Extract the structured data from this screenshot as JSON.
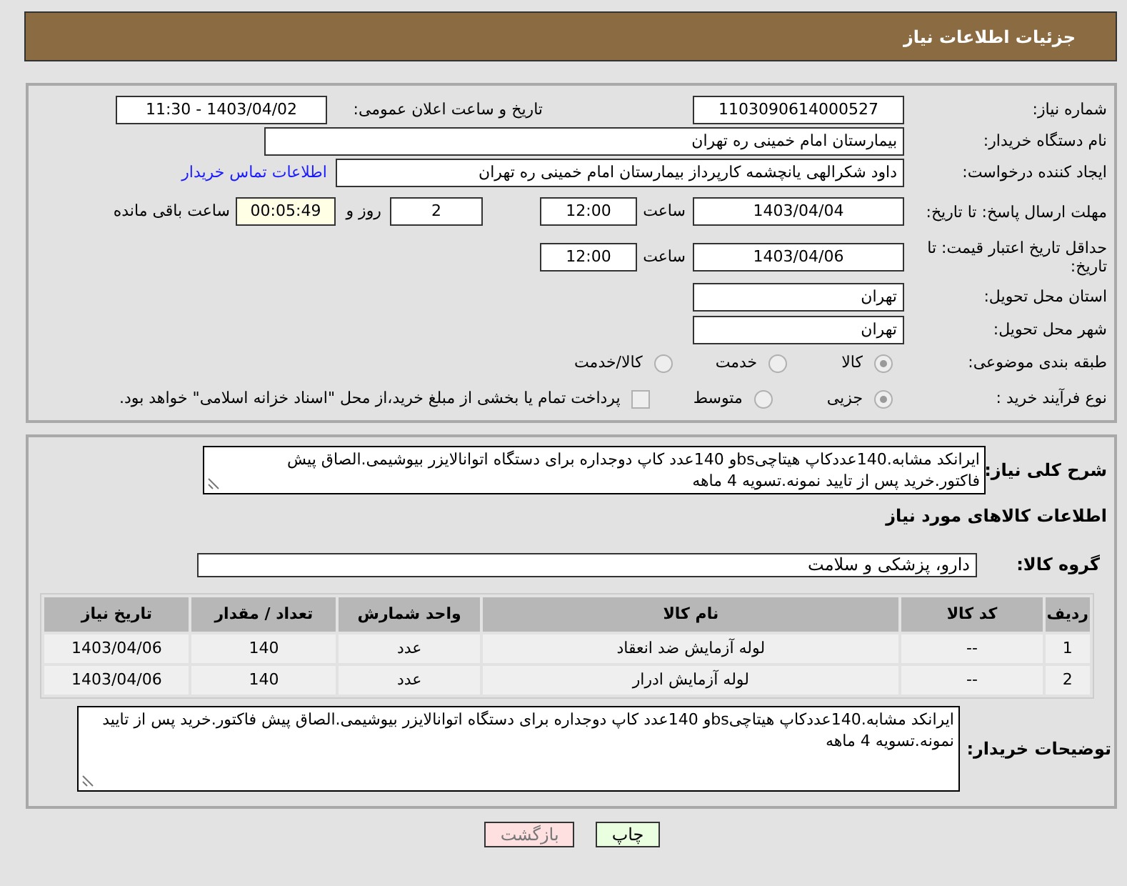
{
  "header": {
    "title": "جزئیات اطلاعات نیاز"
  },
  "need_number": {
    "label": "شماره نیاز:",
    "value": "1103090614000527"
  },
  "announce": {
    "label": "تاریخ و ساعت اعلان عمومی:",
    "value": "1403/04/02 - 11:30"
  },
  "buyer_org": {
    "label": "نام دستگاه خریدار:",
    "value": "بیمارستان امام خمینی ره  تهران"
  },
  "requester": {
    "label": "ایجاد کننده درخواست:",
    "value": "داود شکرالهی یانچشمه کارپرداز بیمارستان امام خمینی ره  تهران",
    "link": "اطلاعات تماس خریدار"
  },
  "response_deadline": {
    "label": "مهلت ارسال پاسخ: تا تاریخ:",
    "date": "1403/04/04",
    "time_label": "ساعت",
    "time": "12:00",
    "days": "2",
    "days_label": "روز و",
    "remaining": "00:05:49",
    "remaining_label": "ساعت باقی مانده"
  },
  "price_validity": {
    "label": "حداقل تاریخ اعتبار قیمت: تا تاریخ:",
    "date": "1403/04/06",
    "time_label": "ساعت",
    "time": "12:00"
  },
  "province": {
    "label": "استان محل تحویل:",
    "value": "تهران"
  },
  "city": {
    "label": "شهر محل تحویل:",
    "value": "تهران"
  },
  "category": {
    "label": "طبقه بندی موضوعی:",
    "options": [
      {
        "label": "کالا",
        "selected": true
      },
      {
        "label": "خدمت",
        "selected": false
      },
      {
        "label": "کالا/خدمت",
        "selected": false
      }
    ]
  },
  "purchase_process": {
    "label": "نوع فرآیند خرید :",
    "options": [
      {
        "label": "جزیی",
        "selected": true
      },
      {
        "label": "متوسط",
        "selected": false
      }
    ],
    "payment_note": {
      "label": "پرداخت تمام یا بخشی از مبلغ خرید،از محل \"اسناد خزانه اسلامی\" خواهد بود.",
      "checked": false
    }
  },
  "description": {
    "label": "شرح کلی نیاز:",
    "value": "ایرانکد مشابه.140عددکاپ هیتاچیbsو 140عدد کاپ دوجداره برای دستگاه اتوانالایزر بیوشیمی.الصاق پیش فاکتور.خرید پس از تایید نمونه.تسویه 4 ماهه"
  },
  "goods_heading": "اطلاعات کالاهای مورد نیاز",
  "goods_group": {
    "label": "گروه کالا:",
    "value": "دارو، پزشکی و سلامت"
  },
  "table": {
    "columns": [
      "ردیف",
      "کد کالا",
      "نام کالا",
      "واحد شمارش",
      "تعداد / مقدار",
      "تاریخ نیاز"
    ],
    "rows": [
      [
        "1",
        "--",
        "لوله آزمایش ضد انعقاد",
        "عدد",
        "140",
        "1403/04/06"
      ],
      [
        "2",
        "--",
        "لوله آزمایش ادرار",
        "عدد",
        "140",
        "1403/04/06"
      ]
    ]
  },
  "buyer_notes": {
    "label": "توضیحات خریدار:",
    "value": "ایرانکد مشابه.140عددکاپ هیتاچیbsو 140عدد کاپ دوجداره برای دستگاه اتوانالایزر بیوشیمی.الصاق پیش فاکتور.خرید پس از تایید نمونه.تسویه 4 ماهه"
  },
  "buttons": [
    {
      "label": "چاپ",
      "kind": "print"
    },
    {
      "label": "بازگشت",
      "kind": "back"
    }
  ]
}
